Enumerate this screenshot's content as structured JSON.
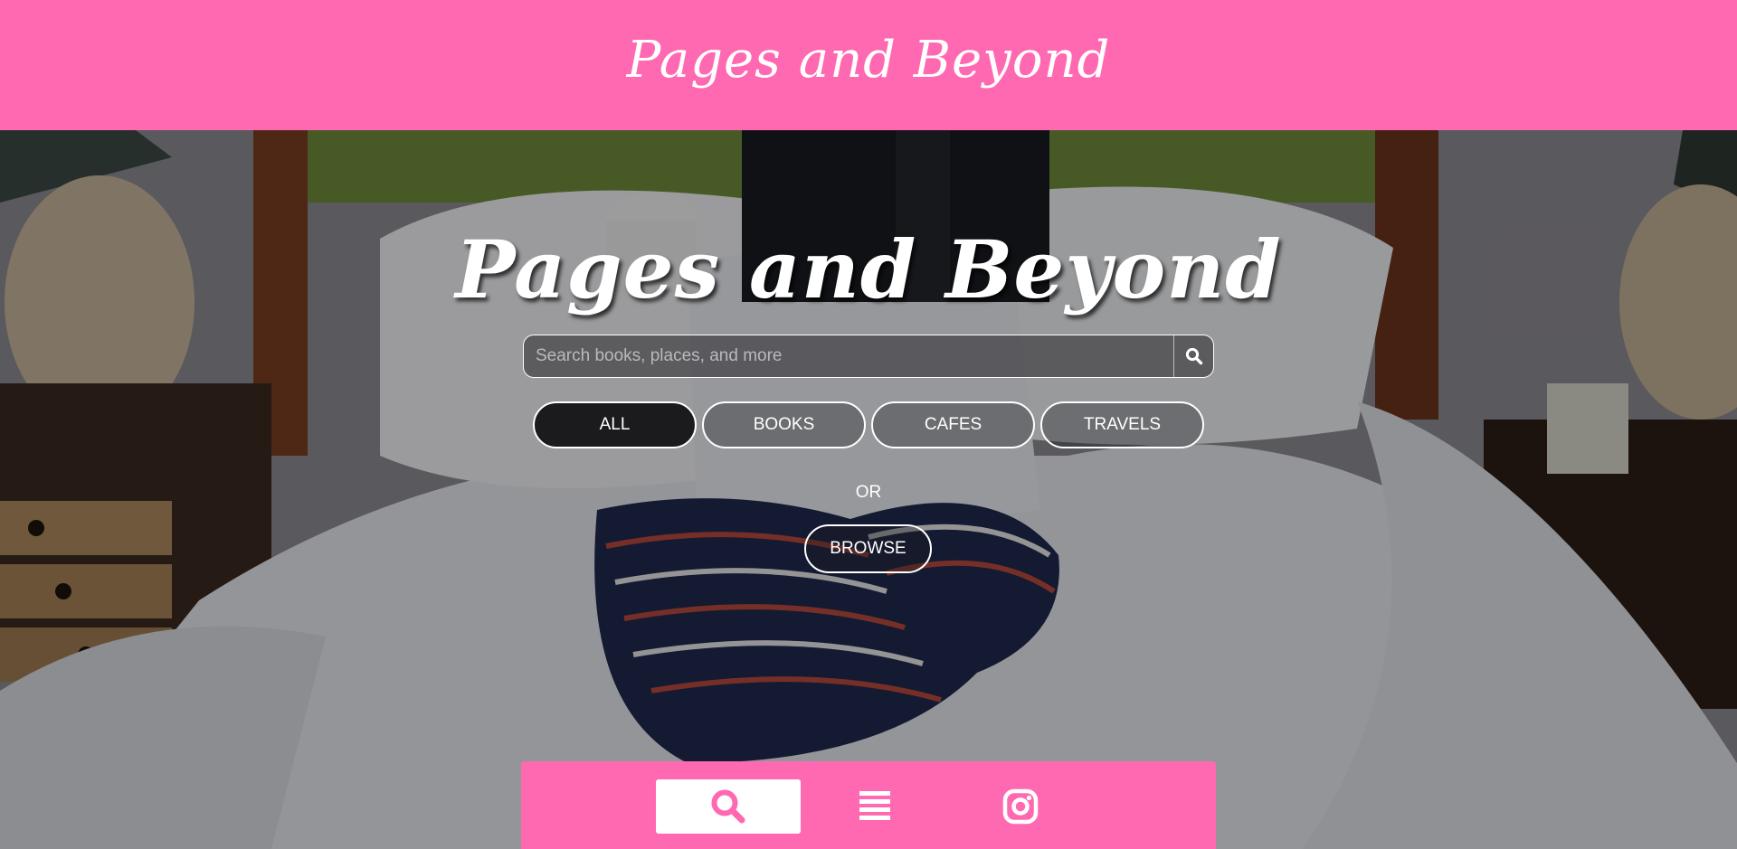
{
  "header": {
    "brand": "Pages and Beyond"
  },
  "hero": {
    "title": "Pages and Beyond",
    "search": {
      "placeholder": "Search books, places, and more",
      "value": ""
    },
    "filters": [
      {
        "label": "ALL",
        "active": true
      },
      {
        "label": "BOOKS",
        "active": false
      },
      {
        "label": "CAFES",
        "active": false
      },
      {
        "label": "TRAVELS",
        "active": false
      }
    ],
    "or_label": "OR",
    "browse_label": "BROWSE"
  },
  "bottom_nav": {
    "items": [
      {
        "icon": "search-icon",
        "active": true
      },
      {
        "icon": "list-icon",
        "active": false
      },
      {
        "icon": "instagram-icon",
        "active": false
      }
    ]
  },
  "colors": {
    "brand_pink": "#ff69b1",
    "white": "#ffffff",
    "dark_pill": "#1b1b1e"
  }
}
